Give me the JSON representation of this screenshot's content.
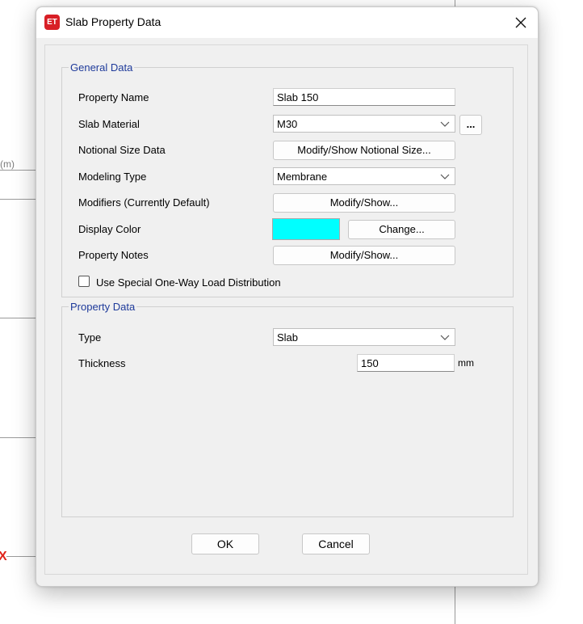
{
  "background": {
    "unit_label": "(m)",
    "x_marker": "X"
  },
  "dialog": {
    "title": "Slab Property Data",
    "app_icon_text": "ET",
    "close_glyph": "✕"
  },
  "general_data": {
    "legend": "General Data",
    "property_name": {
      "label": "Property Name",
      "value": "Slab 150"
    },
    "slab_material": {
      "label": "Slab Material",
      "value": "M30",
      "browse_label": "..."
    },
    "notional_size": {
      "label": "Notional Size Data",
      "button": "Modify/Show Notional Size..."
    },
    "modeling_type": {
      "label": "Modeling Type",
      "value": "Membrane"
    },
    "modifiers": {
      "label": "Modifiers (Currently Default)",
      "button": "Modify/Show..."
    },
    "display_color": {
      "label": "Display Color",
      "color": "#00ffff",
      "button": "Change..."
    },
    "property_notes": {
      "label": "Property Notes",
      "button": "Modify/Show..."
    },
    "one_way_load": {
      "label": "Use Special One-Way Load Distribution",
      "checked": false
    }
  },
  "property_data": {
    "legend": "Property Data",
    "type": {
      "label": "Type",
      "value": "Slab"
    },
    "thickness": {
      "label": "Thickness",
      "value": "150",
      "unit": "mm"
    }
  },
  "footer": {
    "ok": "OK",
    "cancel": "Cancel"
  }
}
